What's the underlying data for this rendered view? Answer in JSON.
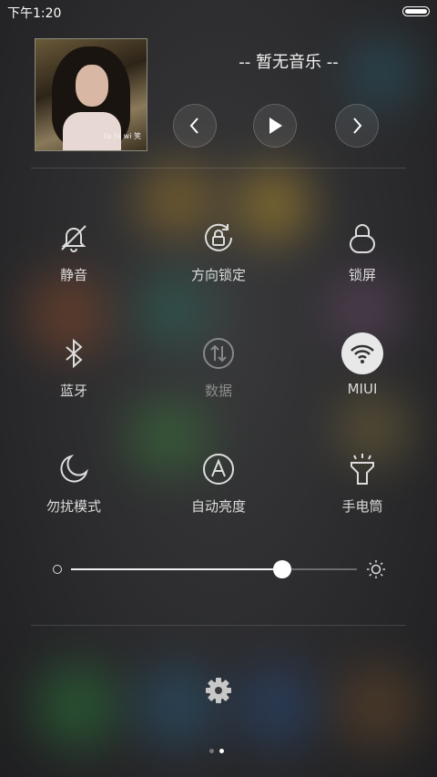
{
  "status_bar": {
    "time": "下午1:20"
  },
  "music": {
    "title": "-- 暂无音乐 --",
    "album_caption": "ta ta wi 笑"
  },
  "toggles": [
    {
      "label": "静音",
      "icon": "mute-bell-icon",
      "state": "off"
    },
    {
      "label": "方向锁定",
      "icon": "rotation-lock-icon",
      "state": "off"
    },
    {
      "label": "锁屏",
      "icon": "lock-icon",
      "state": "off"
    },
    {
      "label": "蓝牙",
      "icon": "bluetooth-icon",
      "state": "off"
    },
    {
      "label": "数据",
      "icon": "mobile-data-icon",
      "state": "disabled"
    },
    {
      "label": "MIUI",
      "icon": "wifi-icon",
      "state": "on"
    },
    {
      "label": "勿扰模式",
      "icon": "moon-icon",
      "state": "off"
    },
    {
      "label": "自动亮度",
      "icon": "auto-brightness-icon",
      "state": "off"
    },
    {
      "label": "手电筒",
      "icon": "flashlight-icon",
      "state": "off"
    }
  ],
  "brightness": {
    "level": 0.74
  },
  "pager": {
    "count": 2,
    "active": 1
  },
  "colors": {
    "active_toggle_bg": "#e8e8e8",
    "label": "#dcdcdc",
    "disabled_label": "#8c8c8c"
  }
}
